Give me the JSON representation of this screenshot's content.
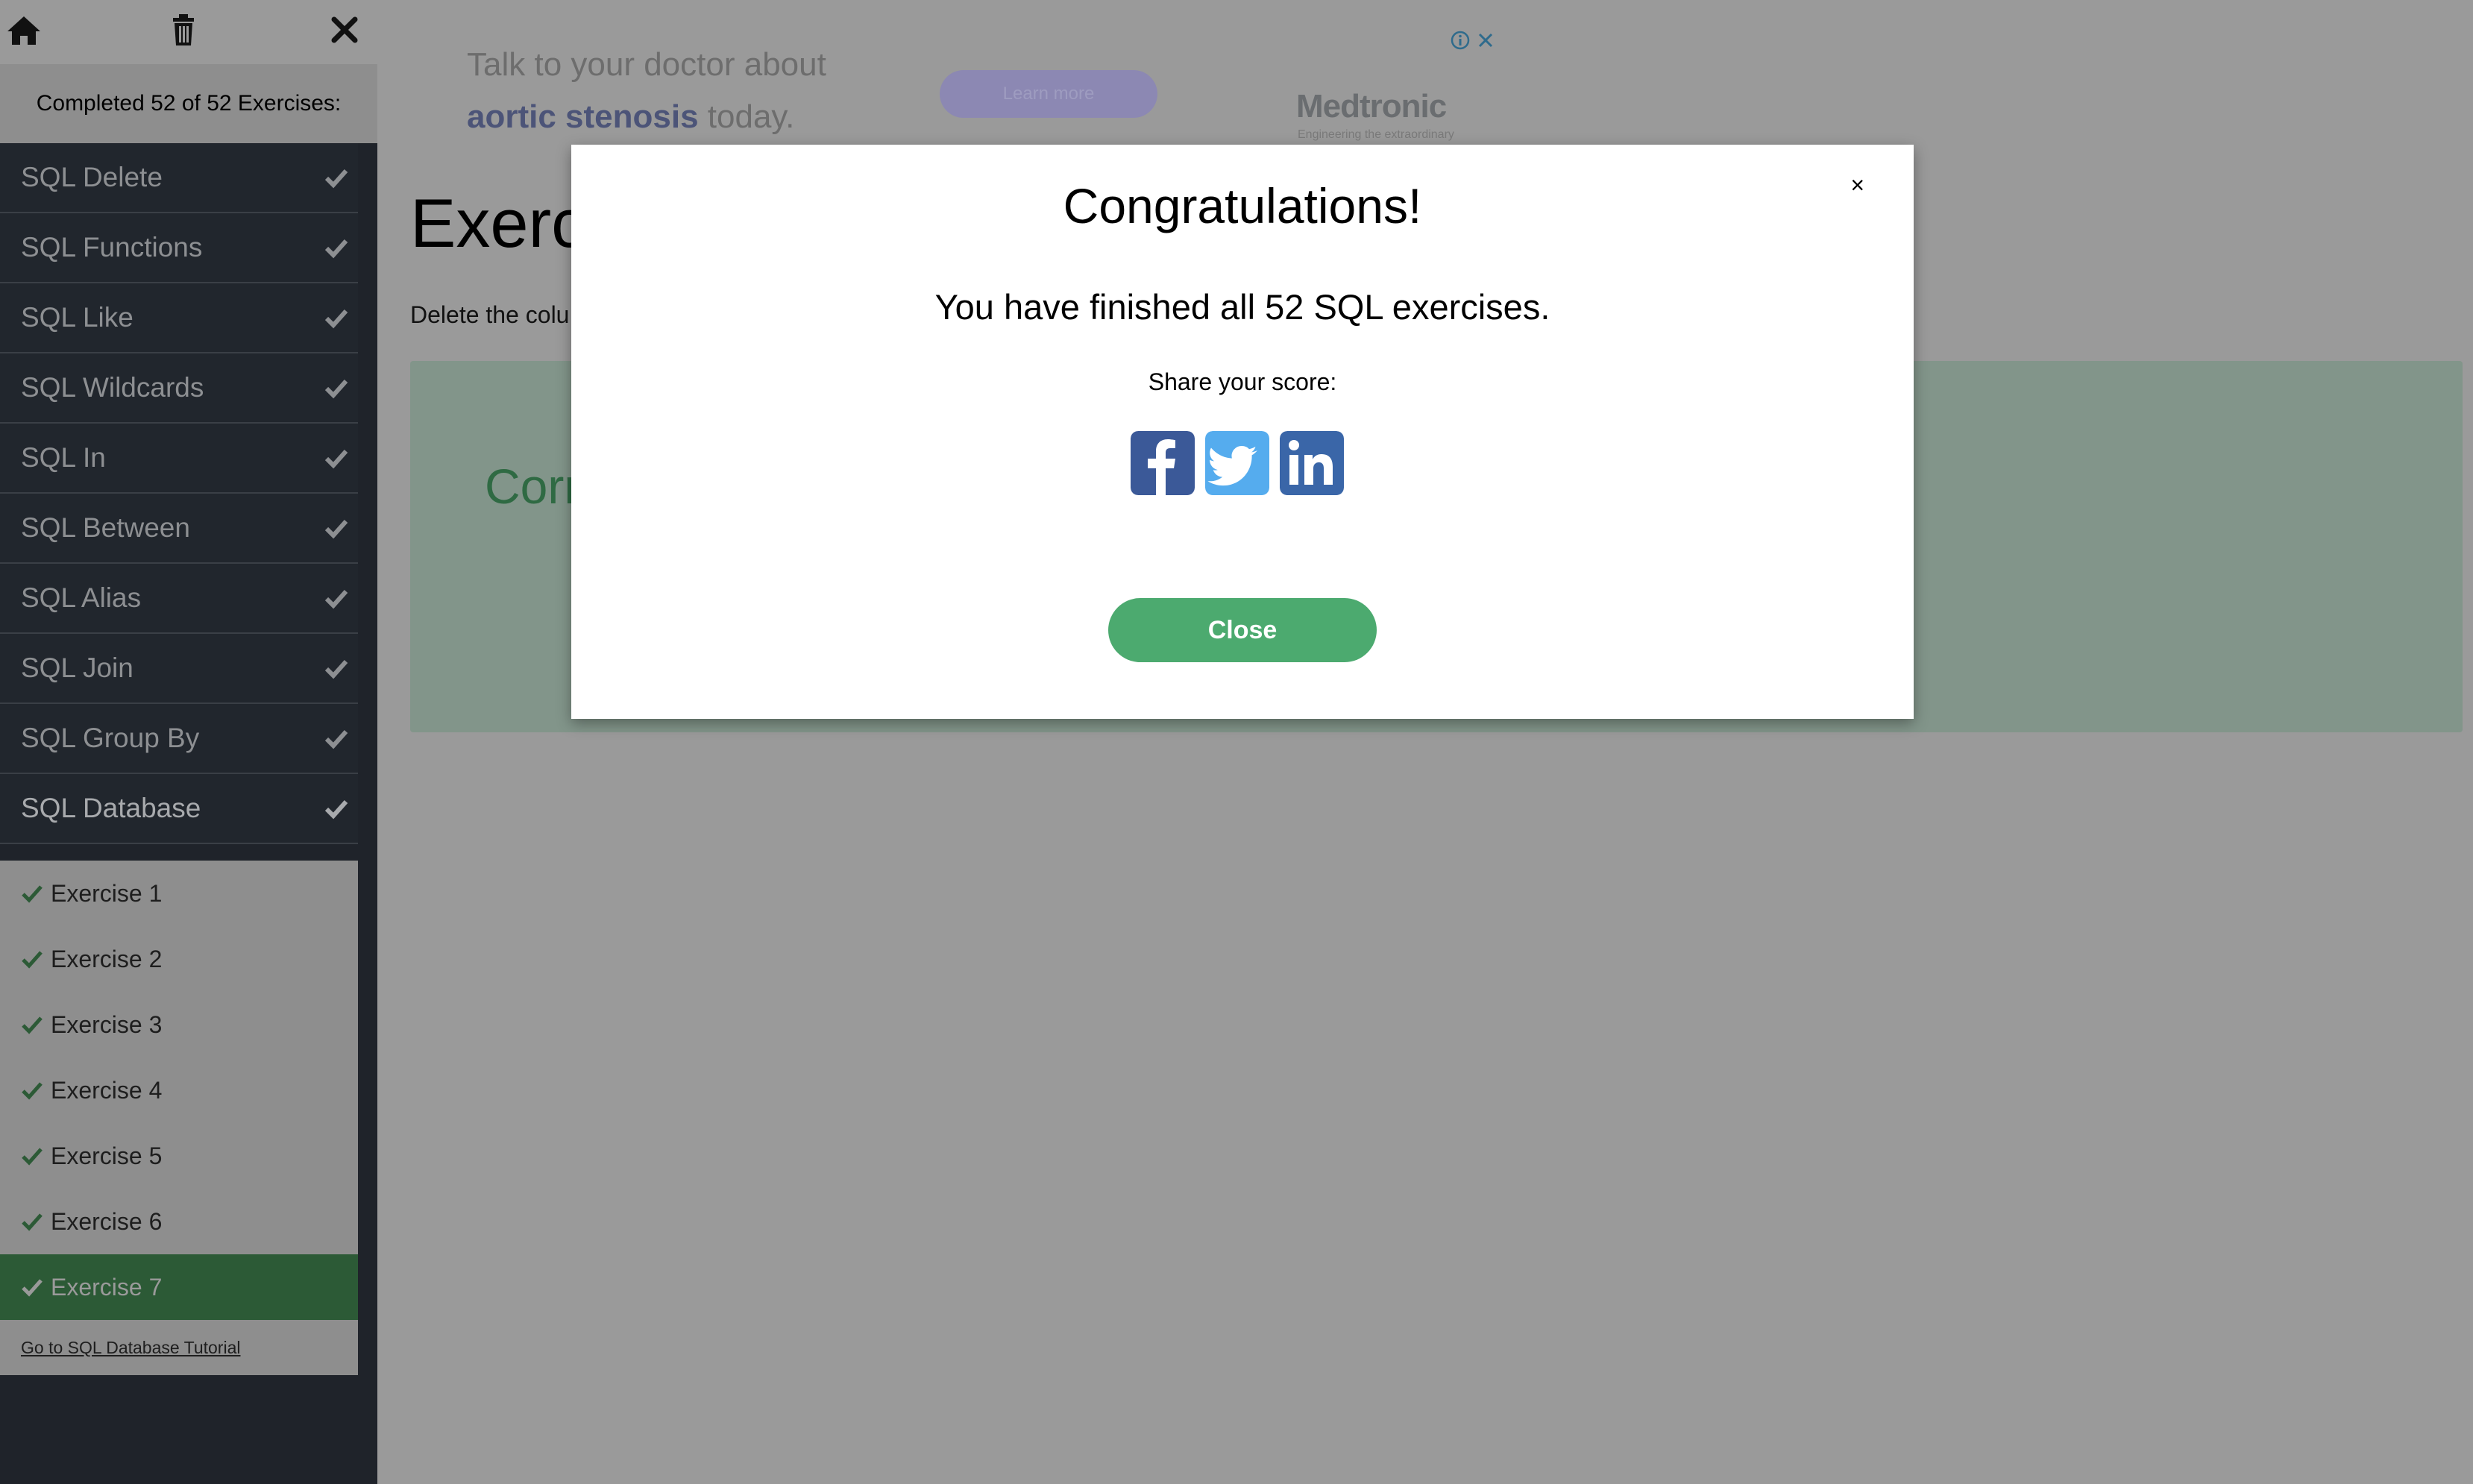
{
  "sidebar": {
    "status": "Completed 52 of 52 Exercises:",
    "categories": [
      {
        "label": "SQL Delete"
      },
      {
        "label": "SQL Functions"
      },
      {
        "label": "SQL Like"
      },
      {
        "label": "SQL Wildcards"
      },
      {
        "label": "SQL In"
      },
      {
        "label": "SQL Between"
      },
      {
        "label": "SQL Alias"
      },
      {
        "label": "SQL Join"
      },
      {
        "label": "SQL Group By"
      },
      {
        "label": "SQL Database"
      }
    ],
    "exercises": [
      {
        "label": "Exercise 1"
      },
      {
        "label": "Exercise 2"
      },
      {
        "label": "Exercise 3"
      },
      {
        "label": "Exercise 4"
      },
      {
        "label": "Exercise 5"
      },
      {
        "label": "Exercise 6"
      },
      {
        "label": "Exercise 7"
      }
    ],
    "tutorial_link": "Go to SQL Database Tutorial",
    "icons": {
      "home": "home-icon",
      "trash": "trash-icon",
      "close": "close-icon",
      "check": "check-icon"
    }
  },
  "ad": {
    "line1": "Talk to your doctor about",
    "line2_highlight": "aortic stenosis",
    "line2_rest": " today.",
    "button": "Learn more",
    "brand": "Medtronic",
    "brand_tagline": "Engineering the extraordinary"
  },
  "main": {
    "heading": "Exerc",
    "description": "Delete the colu",
    "result_text": "Corr"
  },
  "modal": {
    "title": "Congratulations!",
    "message": "You have finished all 52 SQL exercises.",
    "share_label": "Share your score:",
    "close_button": "Close",
    "close_x": "×",
    "share": [
      "facebook-icon",
      "twitter-icon",
      "linkedin-icon"
    ]
  },
  "colors": {
    "sidebar_bg": "#1f232a",
    "accent_green": "#4caa6f",
    "active_exercise_bg": "#2c5a36",
    "facebook": "#3b5998",
    "twitter": "#55acee",
    "linkedin": "#3a66a8"
  }
}
